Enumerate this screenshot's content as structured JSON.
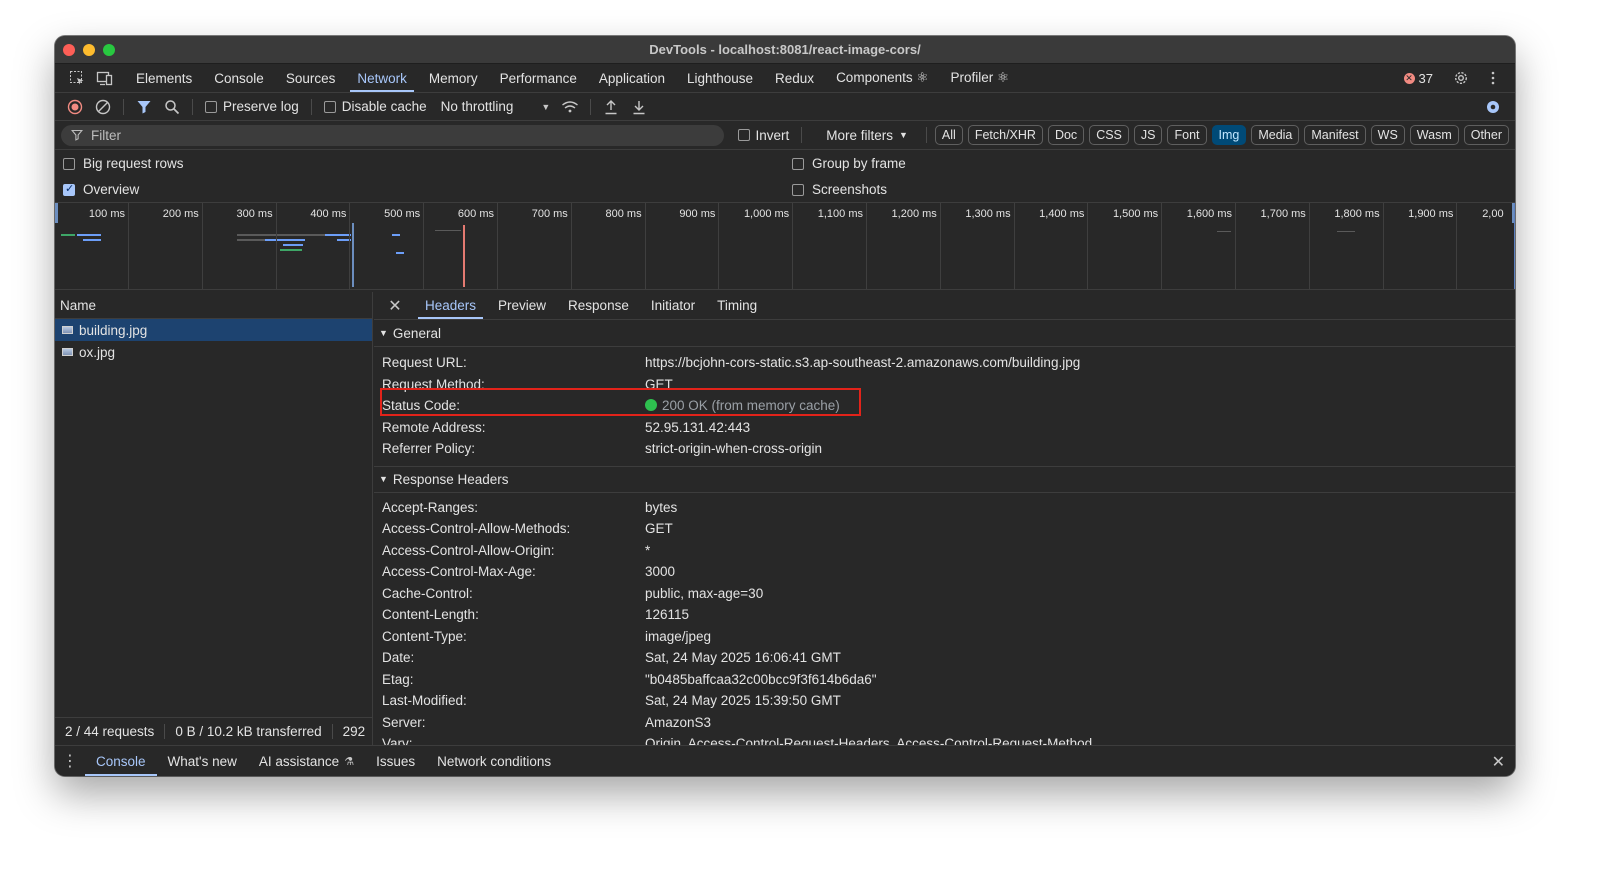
{
  "window": {
    "title": "DevTools - localhost:8081/react-image-cors/"
  },
  "tabs": [
    {
      "label": "Elements"
    },
    {
      "label": "Console"
    },
    {
      "label": "Sources"
    },
    {
      "label": "Network"
    },
    {
      "label": "Memory"
    },
    {
      "label": "Performance"
    },
    {
      "label": "Application"
    },
    {
      "label": "Lighthouse"
    },
    {
      "label": "Redux"
    },
    {
      "label": "Components ⚛"
    },
    {
      "label": "Profiler ⚛"
    }
  ],
  "active_tab": "Network",
  "errors": {
    "count": "37"
  },
  "toolbar": {
    "preserve_log": "Preserve log",
    "disable_cache": "Disable cache",
    "throttling": "No throttling"
  },
  "filterbar": {
    "placeholder": "Filter",
    "invert": "Invert",
    "more_filters": "More filters",
    "chips": [
      "All",
      "Fetch/XHR",
      "Doc",
      "CSS",
      "JS",
      "Font",
      "Img",
      "Media",
      "Manifest",
      "WS",
      "Wasm",
      "Other"
    ],
    "active_chip": "Img"
  },
  "options": {
    "big_request_rows": "Big request rows",
    "overview": "Overview",
    "group_by_frame": "Group by frame",
    "screenshots": "Screenshots"
  },
  "timeline": {
    "ticks": [
      "100 ms",
      "200 ms",
      "300 ms",
      "400 ms",
      "500 ms",
      "600 ms",
      "700 ms",
      "800 ms",
      "900 ms",
      "1,000 ms",
      "1,100 ms",
      "1,200 ms",
      "1,300 ms",
      "1,400 ms",
      "1,500 ms",
      "1,600 ms",
      "1,700 ms",
      "1,800 ms",
      "1,900 ms",
      "2,00"
    ]
  },
  "requests": {
    "header": "Name",
    "rows": [
      {
        "name": "building.jpg",
        "selected": true
      },
      {
        "name": "ox.jpg",
        "selected": false
      }
    ]
  },
  "status": {
    "requests": "2 / 44 requests",
    "transferred": "0 B / 10.2 kB transferred",
    "resources": "292"
  },
  "details": {
    "tabs": [
      "Headers",
      "Preview",
      "Response",
      "Initiator",
      "Timing"
    ],
    "active_tab": "Headers",
    "general_title": "General",
    "general": [
      {
        "key": "Request URL:",
        "value": "https://bcjohn-cors-static.s3.ap-southeast-2.amazonaws.com/building.jpg"
      },
      {
        "key": "Request Method:",
        "value": "GET"
      },
      {
        "key": "Status Code:",
        "value": "200 OK (from memory cache)"
      },
      {
        "key": "Remote Address:",
        "value": "52.95.131.42:443"
      },
      {
        "key": "Referrer Policy:",
        "value": "strict-origin-when-cross-origin"
      }
    ],
    "response_title": "Response Headers",
    "response_headers": [
      {
        "key": "Accept-Ranges:",
        "value": "bytes"
      },
      {
        "key": "Access-Control-Allow-Methods:",
        "value": "GET"
      },
      {
        "key": "Access-Control-Allow-Origin:",
        "value": "*"
      },
      {
        "key": "Access-Control-Max-Age:",
        "value": "3000"
      },
      {
        "key": "Cache-Control:",
        "value": "public, max-age=30"
      },
      {
        "key": "Content-Length:",
        "value": "126115"
      },
      {
        "key": "Content-Type:",
        "value": "image/jpeg"
      },
      {
        "key": "Date:",
        "value": "Sat, 24 May 2025 16:06:41 GMT"
      },
      {
        "key": "Etag:",
        "value": "\"b0485baffcaa32c00bcc9f3f614b6da6\""
      },
      {
        "key": "Last-Modified:",
        "value": "Sat, 24 May 2025 15:39:50 GMT"
      },
      {
        "key": "Server:",
        "value": "AmazonS3"
      },
      {
        "key": "Vary:",
        "value": "Origin, Access-Control-Request-Headers, Access-Control-Request-Method"
      }
    ]
  },
  "drawer": {
    "tabs": [
      "Console",
      "What's new",
      "AI assistance",
      "Issues",
      "Network conditions"
    ],
    "active_tab": "Console"
  },
  "colors": {
    "accent": "#a8c7fa",
    "highlight_box": "#e2231a",
    "status_ok": "#2ec04f",
    "selected_row": "#1d4370"
  }
}
